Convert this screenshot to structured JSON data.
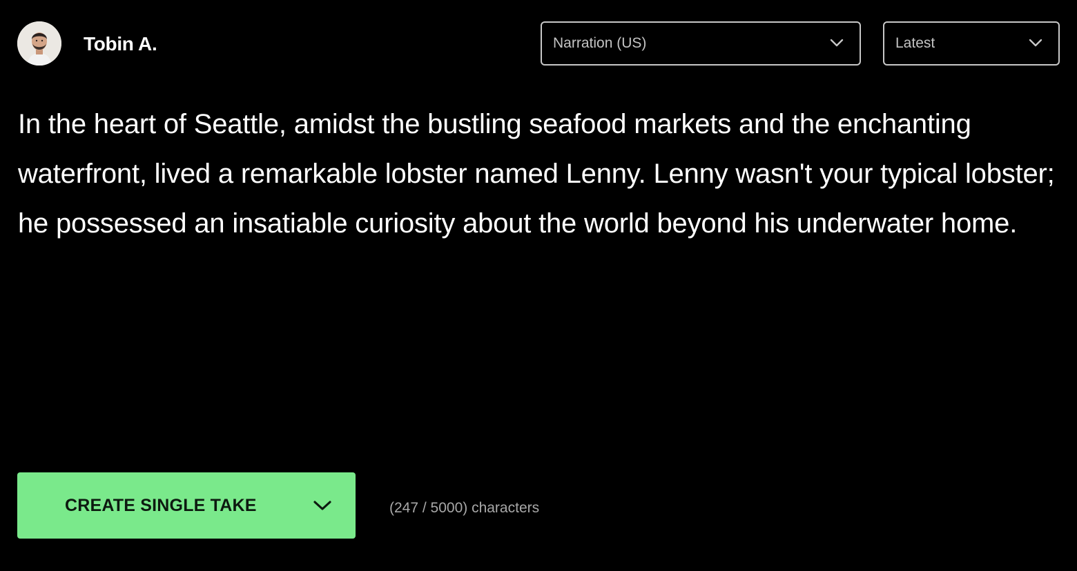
{
  "user": {
    "name": "Tobin A."
  },
  "controls": {
    "voice_select": {
      "value": "Narration (US)"
    },
    "sort_select": {
      "value": "Latest"
    }
  },
  "story": {
    "text": "In the heart of Seattle, amidst the bustling seafood markets and the enchanting waterfront, lived a remarkable lobster named Lenny. Lenny wasn't your typical lobster; he possessed an insatiable curiosity about the world beyond his underwater home."
  },
  "actions": {
    "create_label": "CREATE SINGLE TAKE"
  },
  "footer": {
    "char_count": "(247 / 5000) characters"
  },
  "colors": {
    "background": "#000000",
    "accent": "#7ae98b",
    "text": "#ffffff",
    "muted_text": "#a8a8a8",
    "select_border": "#c8c8c8"
  },
  "icons": {
    "avatar": "user-photo",
    "voice_dropdown": "chevron-down-icon",
    "sort_dropdown": "chevron-down-icon",
    "create_dropdown": "chevron-down-icon"
  }
}
